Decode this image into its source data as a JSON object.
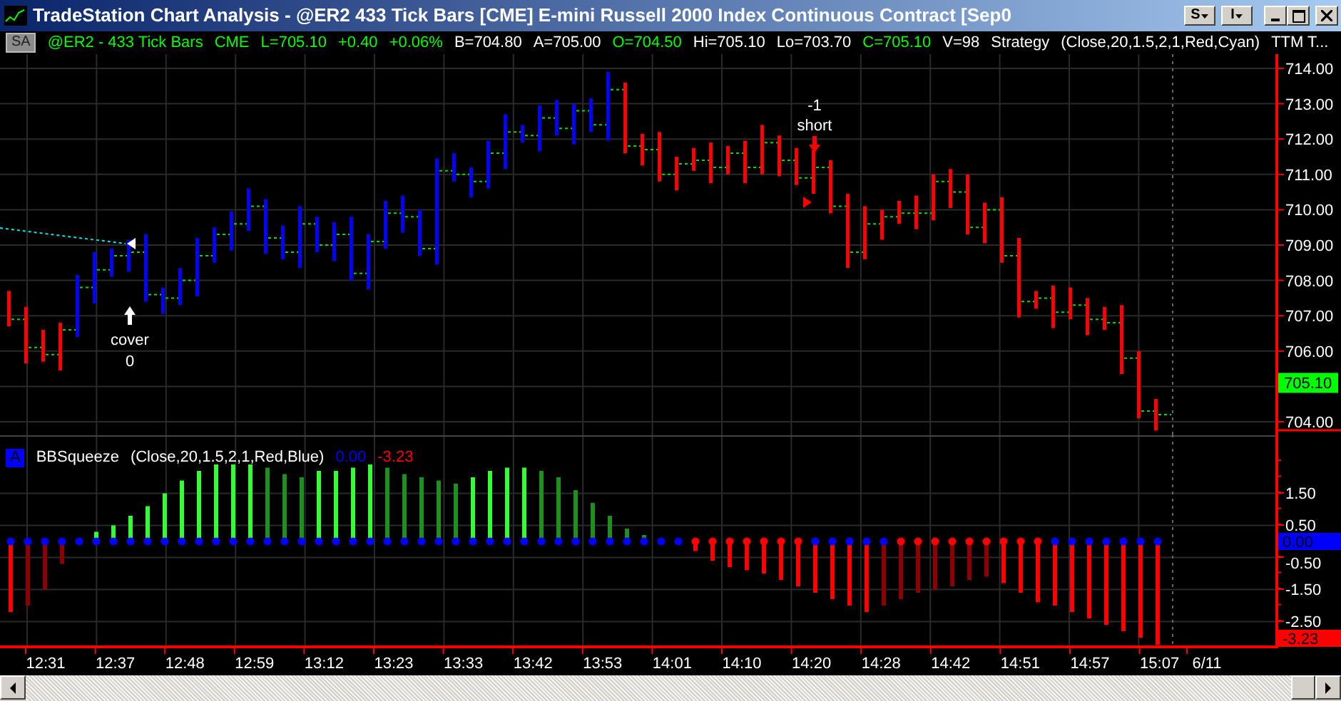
{
  "window": {
    "title": "TradeStation Chart Analysis - @ER2  433 Tick Bars [CME] E-mini Russell 2000 Index Continuous Contract [Sep0",
    "menu_buttons": [
      {
        "label": "S"
      },
      {
        "label": "I"
      }
    ]
  },
  "chart": {
    "badge": "SA",
    "info": [
      {
        "text": "@ER2 - 433 Tick Bars",
        "color": "#00ff00"
      },
      {
        "text": "CME",
        "color": "#00ff00"
      },
      {
        "text": "L=705.10",
        "color": "#00ff00"
      },
      {
        "text": "+0.40",
        "color": "#00ff00"
      },
      {
        "text": "+0.06%",
        "color": "#00ff00"
      },
      {
        "text": "B=704.80",
        "color": "#ffffff"
      },
      {
        "text": "A=705.00",
        "color": "#ffffff"
      },
      {
        "text": "O=704.50",
        "color": "#00ff00"
      },
      {
        "text": "Hi=705.10",
        "color": "#ffffff"
      },
      {
        "text": "Lo=703.70",
        "color": "#ffffff"
      },
      {
        "text": "C=705.10",
        "color": "#00ff00"
      },
      {
        "text": "V=98",
        "color": "#ffffff"
      },
      {
        "text": "Strategy",
        "color": "#ffffff"
      },
      {
        "text": "(Close,20,1.5,2,1,Red,Cyan)",
        "color": "#ffffff"
      },
      {
        "text": "TTM T...",
        "color": "#ffffff"
      }
    ],
    "annotations": [
      {
        "kind": "cover",
        "lines": [
          "cover",
          "0"
        ]
      },
      {
        "kind": "short",
        "lines": [
          "-1",
          "short"
        ]
      }
    ],
    "price_axis": {
      "labels": [
        "714.00",
        "713.00",
        "712.00",
        "711.00",
        "710.00",
        "709.00",
        "708.00",
        "707.00",
        "706.00",
        "704.00"
      ],
      "last_price": "705.10"
    }
  },
  "indicator": {
    "badge": "A",
    "name": "BBSqueeze",
    "params": "(Close,20,1.5,2,1,Red,Blue)",
    "values": [
      {
        "text": "0.00",
        "color": "#0000ff"
      },
      {
        "text": "-3.23",
        "color": "#ff0000"
      }
    ],
    "axis": {
      "labels": [
        "1.50",
        "0.50",
        "-0.50",
        "-1.50",
        "-2.50"
      ],
      "badges": [
        {
          "text": "0.00",
          "color": "#0000ff"
        },
        {
          "text": "-3.23",
          "color": "#ff0000"
        }
      ]
    }
  },
  "time_axis": [
    "12:31",
    "12:37",
    "12:48",
    "12:59",
    "13:12",
    "13:23",
    "13:33",
    "13:42",
    "13:53",
    "14:01",
    "14:10",
    "14:20",
    "14:28",
    "14:42",
    "14:51",
    "14:57",
    "15:07",
    "6/11"
  ]
}
